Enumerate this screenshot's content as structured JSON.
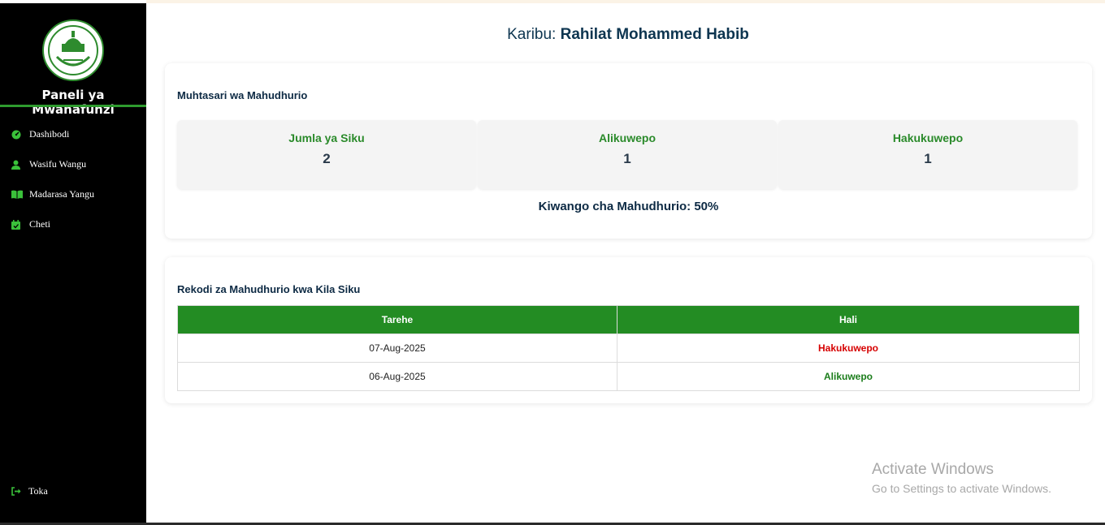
{
  "sidebar": {
    "brand": "Paneli ya Mwanafunzi",
    "items": [
      {
        "label": "Dashibodi",
        "icon": "dashboard-icon"
      },
      {
        "label": "Wasifu Wangu",
        "icon": "user-icon"
      },
      {
        "label": "Madarasa Yangu",
        "icon": "book-icon"
      },
      {
        "label": "Cheti",
        "icon": "calendar-check-icon"
      }
    ],
    "logout": "Toka"
  },
  "header": {
    "welcome_prefix": "Karibu:",
    "student_name": "Rahilat Mohammed Habib"
  },
  "summary": {
    "title": "Muhtasari wa Mahudhurio",
    "stats": [
      {
        "label": "Jumla ya Siku",
        "value": "2"
      },
      {
        "label": "Alikuwepo",
        "value": "1"
      },
      {
        "label": "Hakukuwepo",
        "value": "1"
      }
    ],
    "rate": "Kiwango cha Mahudhurio: 50%"
  },
  "records": {
    "title": "Rekodi za Mahudhurio kwa Kila Siku",
    "columns": [
      "Tarehe",
      "Hali"
    ],
    "rows": [
      {
        "date": "07-Aug-2025",
        "status": "Hakukuwepo"
      },
      {
        "date": "06-Aug-2025",
        "status": "Alikuwepo"
      }
    ]
  },
  "watermark": {
    "line1": "Activate Windows",
    "line2": "Go to Settings to activate Windows."
  },
  "colors": {
    "accent": "#238c23",
    "absent": "#d60000",
    "present": "#1b7d1b",
    "sidebar": "#000000"
  }
}
